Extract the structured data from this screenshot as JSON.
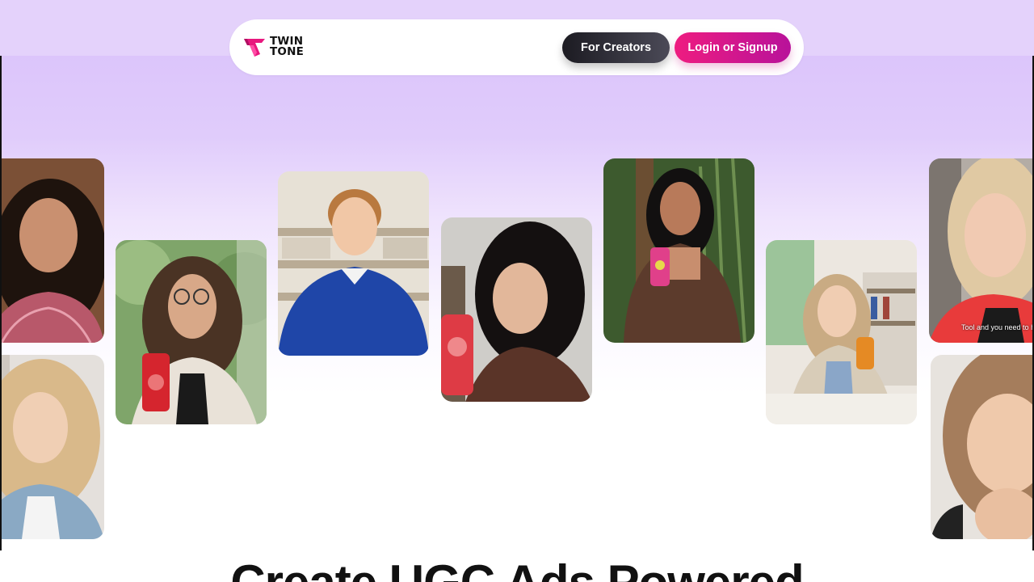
{
  "brand": {
    "name_line1": "TWIN",
    "name_line2": "TONE",
    "primary_color": "#e8177e"
  },
  "nav": {
    "creators_label": "For Creators",
    "login_label": "Login or Signup"
  },
  "gallery": {
    "cards": [
      {
        "name": "creator-card-1",
        "description": "woman in pink plaid shirt"
      },
      {
        "name": "creator-card-2",
        "description": "woman in denim jacket"
      },
      {
        "name": "creator-card-3",
        "description": "woman with glasses holding red can"
      },
      {
        "name": "creator-card-4",
        "description": "man in blue sweater"
      },
      {
        "name": "creator-card-5",
        "description": "woman holding red can"
      },
      {
        "name": "creator-card-6",
        "description": "woman holding pink can outdoors"
      },
      {
        "name": "creator-card-7",
        "description": "woman holding orange can on bed"
      },
      {
        "name": "creator-card-8",
        "description": "woman talking to camera"
      },
      {
        "name": "creator-card-9",
        "description": "woman resting chin on hand"
      }
    ],
    "caption_card_8": "Tool and you need to he"
  },
  "hero": {
    "headline": "Create UGC Ads Powered"
  },
  "colors": {
    "top_band": "#e4d2fb",
    "hero_top": "#dcc5fb",
    "creators_button": "#1c1b22",
    "login_button": "#ee1c80"
  }
}
